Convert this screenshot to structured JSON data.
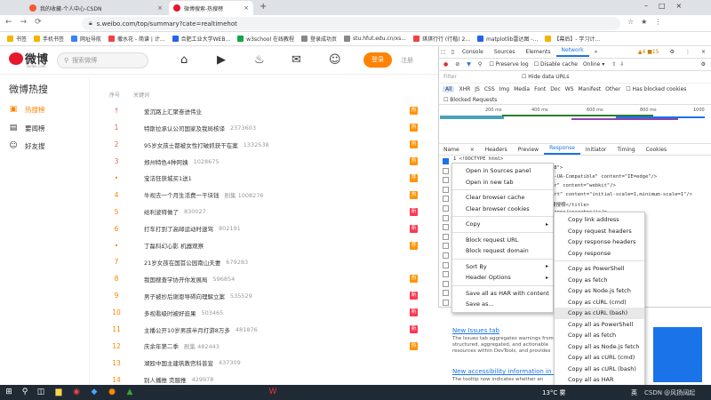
{
  "browser": {
    "tabs": [
      {
        "title": "我的收藏-个人中心-CSDN",
        "active": false
      },
      {
        "title": "微博搜索-热搜榜",
        "active": true
      }
    ],
    "url": "s.weibo.com/top/summary?cate=realtimehot",
    "bookmarks": [
      "书签",
      "手机书签",
      "网址导航",
      "撒水花 - 简谱 | 计...",
      "合肥工业大学WEB...",
      "w3school 在线教程",
      "登录成功页",
      "stu.hfut.edu.cn/xs...",
      "琪琪行行 (行楷) 2...",
      "matplotlib雷达图 -...",
      "【幕后】- 学习计..."
    ]
  },
  "weibo": {
    "logo": "微博",
    "logo_sub": "weibo.com",
    "search_placeholder": "搜索微博",
    "login": "登录",
    "register": "注册",
    "page_title": "微博热搜",
    "side": [
      {
        "label": "热搜榜",
        "active": true
      },
      {
        "label": "要闻榜",
        "active": false
      },
      {
        "label": "好友搜",
        "active": false
      }
    ],
    "col_rank": "序号",
    "col_keyword": "关键词",
    "rows": [
      {
        "rank": "",
        "title": "爱沉路上汇聚奋进伟业",
        "count": "",
        "badge": "热",
        "badge_color": "#ff9406"
      },
      {
        "rank": "1",
        "title": "特斯拉承认公司国家及我局核译",
        "count": "2373603",
        "badge": "热",
        "badge_color": "#ff9406"
      },
      {
        "rank": "2",
        "title": "95岁女孩士都被女性打破抓获干在案",
        "count": "1332538",
        "badge": "热",
        "badge_color": "#ff9406"
      },
      {
        "rank": "3",
        "title": "郑州特色4种阿姨",
        "count": "1028675",
        "badge": "热",
        "badge_color": "#ff9406"
      },
      {
        "rank": "•",
        "title": "宝洁狂获城买1送1",
        "count": "",
        "badge": "荐",
        "badge_color": "#ff9406"
      },
      {
        "rank": "4",
        "title": "牛视去一个月生活费一干块钱",
        "count": "剧集 1008276",
        "badge": "热",
        "badge_color": "#ff9406"
      },
      {
        "rank": "5",
        "title": "给利波特做了",
        "count": "830027",
        "badge": "新",
        "badge_color": "#ff3852"
      },
      {
        "rank": "6",
        "title": "打车打到了高邮运动时速驾",
        "count": "802191",
        "badge": "新",
        "badge_color": "#ff3852"
      },
      {
        "rank": "•",
        "title": "丁磊科幻心影 机器观察",
        "count": "",
        "badge": "荐",
        "badge_color": "#ff9406"
      },
      {
        "rank": "7",
        "title": "21岁女孩在国首公园南山夫妻",
        "count": "679283",
        "badge": "",
        "badge_color": ""
      },
      {
        "rank": "8",
        "title": "我国搜查学协开你发展局",
        "count": "596854",
        "badge": "热",
        "badge_color": "#ff9406"
      },
      {
        "rank": "9",
        "title": "男子被抄后谢恩导碍向理解立案",
        "count": "535529",
        "badge": "新",
        "badge_color": "#ff3852"
      },
      {
        "rank": "10",
        "title": "多视看级时被好逛果",
        "count": "503465",
        "badge": "新",
        "badge_color": "#ff3852"
      },
      {
        "rank": "11",
        "title": "主播公开10岁男孩半月打游8万多",
        "count": "481876",
        "badge": "新",
        "badge_color": "#ff3852"
      },
      {
        "rank": "12",
        "title": "庆余年第二季",
        "count": "剧集 482443",
        "badge": "热",
        "badge_color": "#ff9406"
      },
      {
        "rank": "13",
        "title": "湖殴中国主建筑教宫科普宣",
        "count": "437309",
        "badge": "",
        "badge_color": ""
      },
      {
        "rank": "14",
        "title": "别人播推 克服推",
        "count": "429978",
        "badge": "",
        "badge_color": ""
      }
    ]
  },
  "devtools": {
    "tabs": [
      "Console",
      "Sources",
      "Elements",
      "Network",
      "»"
    ],
    "active_tab": "Network",
    "badges": "▲4  ■15",
    "toolbar": {
      "preserve_log": "Preserve log",
      "disable_cache": "Disable cache",
      "throttle": "Online"
    },
    "filter_label": "Filter",
    "hide_data_urls": "Hide data URLs",
    "types": [
      "All",
      "XHR",
      "JS",
      "CSS",
      "Img",
      "Media",
      "Font",
      "Doc",
      "WS",
      "Manifest",
      "Other"
    ],
    "blocked_cookies": "Has blocked cookies",
    "blocked_requests": "Blocked Requests",
    "timeline_labels": [
      "200 ms",
      "400 ms",
      "600 ms",
      "800 ms",
      "1000"
    ],
    "req_tabs": [
      "Name",
      "×",
      "Headers",
      "Preview",
      "Response",
      "Initiator",
      "Timing",
      "Cookies"
    ],
    "active_req_tab": "Response",
    "code_lines": [
      "1  <!DOCTYPE html>",
      "-8\">",
      "X-UA-Compatible\" content=\"IE=edge\"/>",
      "er\" content=\"webkit\"/>",
      "ort\" content=\"initial-scale=1,minimum-scale=1\"/>",
      "搜搜榜</title>",
      "/apps/searchpc/js/p",
      "cn/t6/appsj/searchpc",
      "",
      "s.cn/t6/apps/searchpc",
      "/apps/searchpc/css/w",
      "/apps/searchpc/css/c",
      "/apps/searchpc/css/n",
      "/apps/searchpc/css/g",
      "/apps/searchpc/css/a",
      "/apps/searchpc/css/a",
      "/apps/searchpc/css/c"
    ],
    "news": [
      {
        "title": "New Issues tab",
        "body": "The Issues tab aggregates warnings from... structured, aggregated, and actionable resources within DevTools, and provides"
      },
      {
        "title": "New accessibility information in the",
        "body": "The tooltip now indicates whether an"
      }
    ]
  },
  "context_menu": {
    "items": [
      {
        "label": "Open in Sources panel",
        "sep_after": false,
        "arrow": false
      },
      {
        "label": "Open in new tab",
        "sep_after": true,
        "arrow": false
      },
      {
        "label": "Clear browser cache",
        "sep_after": false,
        "arrow": false
      },
      {
        "label": "Clear browser cookies",
        "sep_after": true,
        "arrow": false
      },
      {
        "label": "Copy",
        "sep_after": true,
        "arrow": true
      },
      {
        "label": "Block request URL",
        "sep_after": false,
        "arrow": false
      },
      {
        "label": "Block request domain",
        "sep_after": true,
        "arrow": false
      },
      {
        "label": "Sort By",
        "sep_after": false,
        "arrow": true
      },
      {
        "label": "Header Options",
        "sep_after": true,
        "arrow": true
      },
      {
        "label": "Save all as HAR with content",
        "sep_after": false,
        "arrow": false
      },
      {
        "label": "Save as...",
        "sep_after": false,
        "arrow": false
      }
    ]
  },
  "copy_submenu": {
    "items": [
      {
        "label": "Copy link address",
        "sep_after": false,
        "hl": false
      },
      {
        "label": "Copy request headers",
        "sep_after": false,
        "hl": false
      },
      {
        "label": "Copy response headers",
        "sep_after": false,
        "hl": false
      },
      {
        "label": "Copy response",
        "sep_after": true,
        "hl": false
      },
      {
        "label": "Copy as PowerShell",
        "sep_after": false,
        "hl": false
      },
      {
        "label": "Copy as fetch",
        "sep_after": false,
        "hl": false
      },
      {
        "label": "Copy as Node.js fetch",
        "sep_after": false,
        "hl": false
      },
      {
        "label": "Copy as cURL (cmd)",
        "sep_after": false,
        "hl": false
      },
      {
        "label": "Copy as cURL (bash)",
        "sep_after": false,
        "hl": true
      },
      {
        "label": "Copy all as PowerShell",
        "sep_after": false,
        "hl": false
      },
      {
        "label": "Copy all as fetch",
        "sep_after": false,
        "hl": false
      },
      {
        "label": "Copy all as Node.js fetch",
        "sep_after": false,
        "hl": false
      },
      {
        "label": "Copy all as cURL (cmd)",
        "sep_after": false,
        "hl": false
      },
      {
        "label": "Copy all as cURL (bash)",
        "sep_after": false,
        "hl": false
      },
      {
        "label": "Copy all as HAR",
        "sep_after": false,
        "hl": false
      }
    ]
  },
  "taskbar": {
    "weather": "13°C 雾",
    "watermark": "CSDN @风扬阔起",
    "lang": "英"
  }
}
